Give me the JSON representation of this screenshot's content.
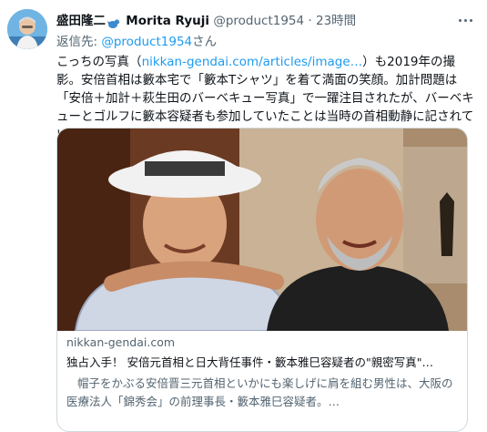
{
  "tweet": {
    "display_name": "盛田隆二",
    "bird_emoji": "bird-emoji-icon",
    "secondary_name": "Morita Ryuji",
    "handle": "@product1954",
    "separator": "·",
    "timestamp": "23時間",
    "reply_prefix": "返信先:",
    "reply_handle": "@product1954",
    "reply_suffix": "さん",
    "text_before_link": "こっちの写真（",
    "link_text": "nikkan-gendai.com/articles/image…",
    "text_after_link": "）も2019年の撮影。安倍首相は籔本宅で「籔本Tシャツ」を着て満面の笑顔。加計問題は「安倍＋加計＋萩生田のバーベキュー写真」で一躍注目されたが、バーベキューとゴルフに籔本容疑者も参加していたことは当時の首相動静に記されている"
  },
  "card": {
    "domain": "nikkan-gendai.com",
    "title": "独占入手！ 安倍元首相と日大背任事件・籔本雅巳容疑者の\"親密写真\"…",
    "description": "帽子をかぶる安倍晋三元首相といかにも楽しげに肩を組む男性は、大阪の医療法人「錦秀会」の前理事長・籔本雅巳容疑者。…"
  },
  "colors": {
    "link": "#1d9bf0",
    "secondary_text": "#536471",
    "primary_text": "#0f1419",
    "border": "#cfd9de"
  },
  "icons": {
    "more": "more-dots-icon",
    "avatar": "avatar-photo"
  }
}
